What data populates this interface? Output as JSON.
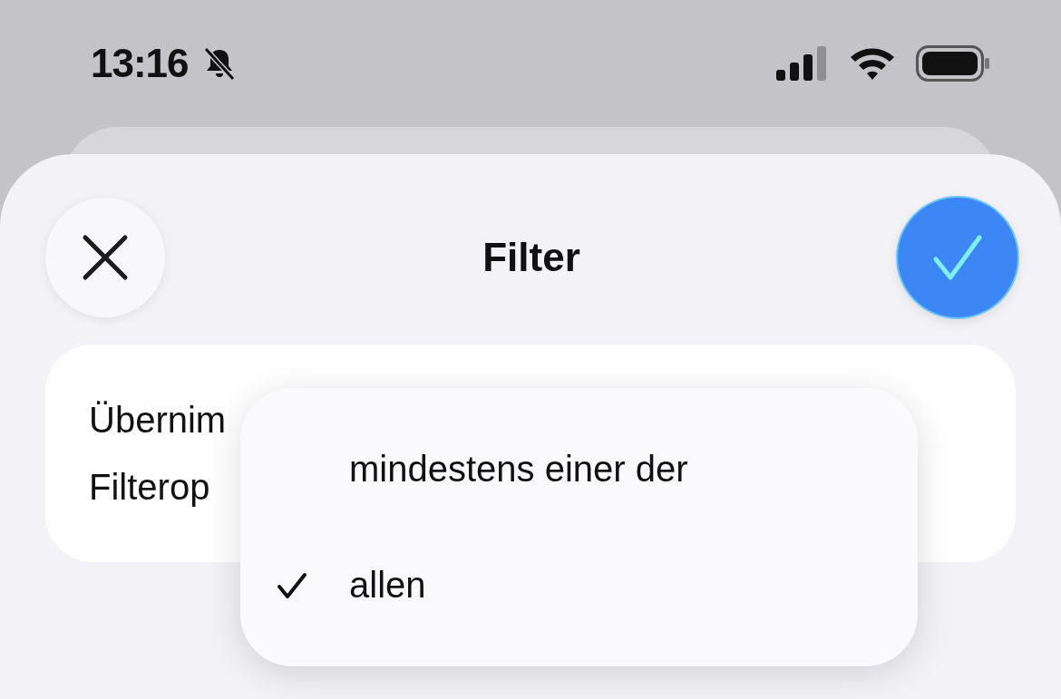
{
  "status_bar": {
    "time": "13:16"
  },
  "header": {
    "title": "Filter"
  },
  "card": {
    "lines": [
      "Übernim",
      "Filterop"
    ]
  },
  "menu": {
    "items": [
      {
        "label": "mindestens einer der",
        "selected": false
      },
      {
        "label": "allen",
        "selected": true
      }
    ]
  }
}
